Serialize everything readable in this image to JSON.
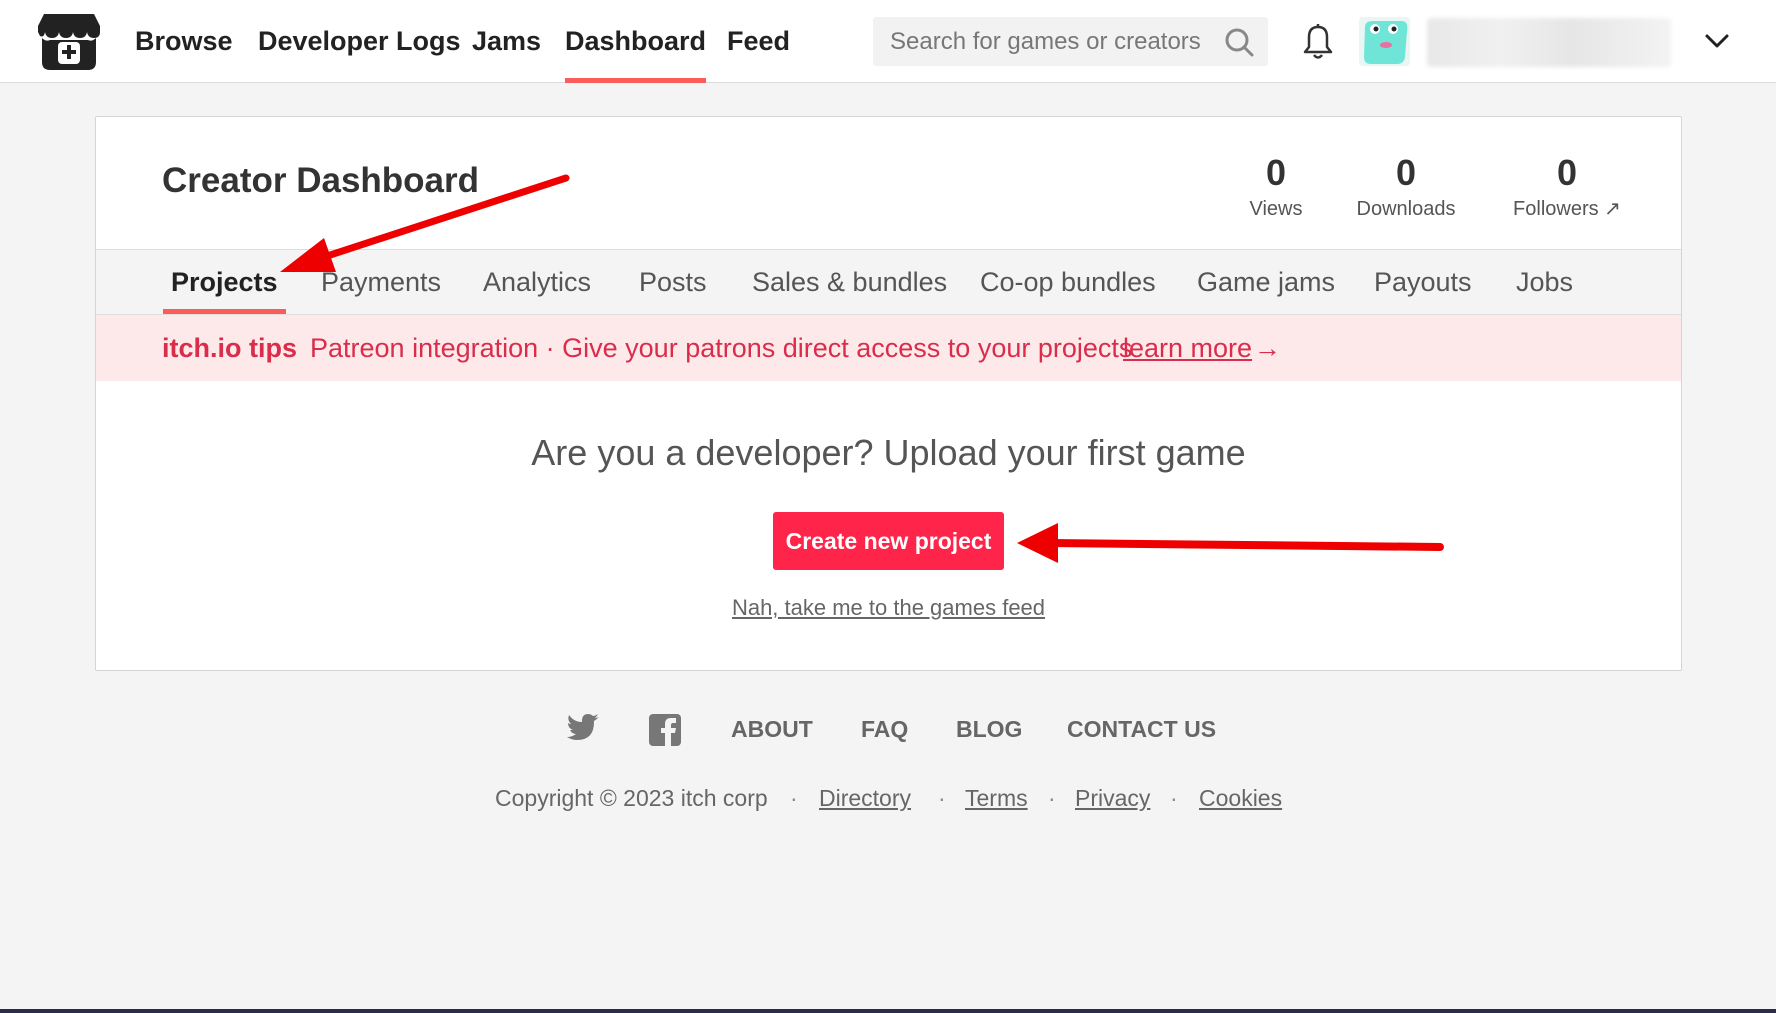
{
  "header": {
    "nav": [
      "Browse",
      "Developer Logs",
      "Jams",
      "Dashboard",
      "Feed"
    ],
    "active_nav": "Dashboard",
    "search_placeholder": "Search for games or creators"
  },
  "dashboard": {
    "title": "Creator Dashboard",
    "stats": [
      {
        "value": "0",
        "label": "Views"
      },
      {
        "value": "0",
        "label": "Downloads"
      },
      {
        "value": "0",
        "label": "Followers ↗"
      }
    ],
    "tabs": [
      "Projects",
      "Payments",
      "Analytics",
      "Posts",
      "Sales & bundles",
      "Co-op bundles",
      "Game jams",
      "Payouts",
      "Jobs"
    ],
    "active_tab": "Projects",
    "tips": {
      "label": "itch.io tips",
      "text": "Patreon integration · Give your patrons direct access to your projects",
      "link": "learn more",
      "arrow": "→"
    },
    "upload_heading": "Are you a developer? Upload your first game",
    "create_button": "Create new project",
    "feed_link": "Nah, take me to the games feed"
  },
  "footer": {
    "links": [
      "ABOUT",
      "FAQ",
      "BLOG",
      "CONTACT US"
    ],
    "copyright": "Copyright © 2023 itch corp",
    "bottom_links": [
      "Directory",
      "Terms",
      "Privacy",
      "Cookies"
    ],
    "separator": "·"
  },
  "colors": {
    "accent": "#fa5c5c",
    "button": "#ff2449",
    "tips_bg": "#fde9ea",
    "tips_text": "#da2c4b",
    "annotation_arrow": "#ee0000"
  },
  "icons": [
    "itchio-logo-icon",
    "search-icon",
    "bell-icon",
    "avatar",
    "chevron-down-icon",
    "twitter-icon",
    "facebook-icon"
  ]
}
